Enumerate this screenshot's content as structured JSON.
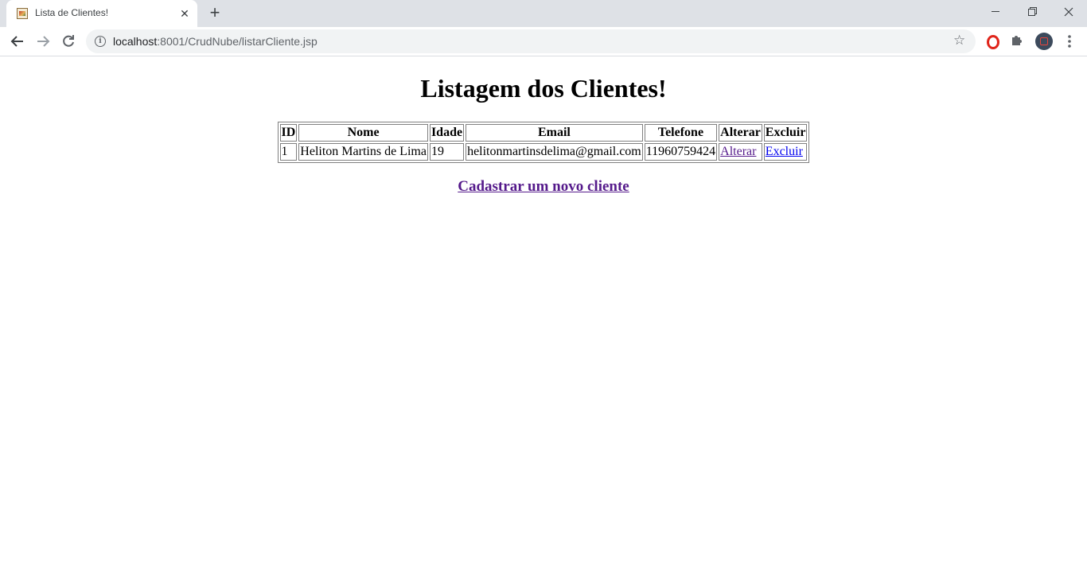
{
  "browser": {
    "tab_title": "Lista de Clientes!",
    "new_tab_symbol": "+",
    "close_symbol": "✕",
    "url_host": "localhost",
    "url_path": ":8001/CrudNube/listarCliente.jsp"
  },
  "page": {
    "heading": "Listagem dos Clientes!",
    "table": {
      "headers": [
        "ID",
        "Nome",
        "Idade",
        "Email",
        "Telefone",
        "Alterar",
        "Excluir"
      ],
      "rows": [
        {
          "id": "1",
          "nome": "Heliton Martins de Lima",
          "idade": "19",
          "email": "helitonmartinsdelima@gmail.com",
          "telefone": "11960759424",
          "alterar": "Alterar",
          "excluir": "Excluir"
        }
      ]
    },
    "new_client_link": "Cadastrar um novo cliente"
  },
  "colors": {
    "link": "#0000ee",
    "visited_link": "#551a8b",
    "tabstrip": "#dee1e6"
  }
}
